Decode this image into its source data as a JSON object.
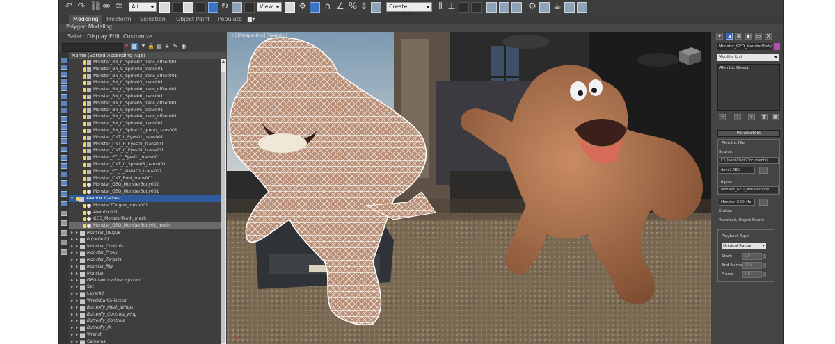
{
  "toolbar": {
    "selection_filter": "All",
    "ref_coord": "View",
    "named_selection": "Create Selection Se"
  },
  "ribbon": {
    "tabs": [
      "Modeling",
      "Freeform",
      "Selection",
      "Object Paint",
      "Populate"
    ],
    "active_tab": "Modeling",
    "sub_panel": "Polygon Modeling"
  },
  "scene_explorer": {
    "menu": [
      "Select",
      "Display",
      "Edit",
      "Customize"
    ],
    "column_header": "Name (Sorted Ascending Age)",
    "rows": [
      {
        "name": "Monster_BN_C_Spine02_trans_offset001",
        "kind": "node"
      },
      {
        "name": "Monster_BN_C_Spine02_trans001",
        "kind": "node"
      },
      {
        "name": "Monster_BN_C_Spine03_trans_offset001",
        "kind": "node"
      },
      {
        "name": "Monster_BN_C_Spine03_trans001",
        "kind": "node"
      },
      {
        "name": "Monster_BN_C_Spine06_trans_offset001",
        "kind": "node"
      },
      {
        "name": "Monster_BN_C_Spine06_trans001",
        "kind": "node"
      },
      {
        "name": "Monster_BN_C_Spine05_trans_offset001",
        "kind": "node"
      },
      {
        "name": "Monster_BN_C_Spine05_trans001",
        "kind": "node"
      },
      {
        "name": "Monster_BN_C_Spine04_trans_offset001",
        "kind": "node"
      },
      {
        "name": "Monster_BN_C_Spine04_trans001",
        "kind": "node"
      },
      {
        "name": "Monster_BN_C_Spine12_group_trans001",
        "kind": "node"
      },
      {
        "name": "Monster_CNT_L_Eyes01_trans001",
        "kind": "node"
      },
      {
        "name": "Monster_CNT_R_Eyes01_trans001",
        "kind": "node"
      },
      {
        "name": "Monster_CNT_C_Eyes01_trans001",
        "kind": "node"
      },
      {
        "name": "Monster_PT_C_Eyes01_trans001",
        "kind": "node"
      },
      {
        "name": "Monster_CNT_C_Spine06_trans001",
        "kind": "node"
      },
      {
        "name": "Monster_PT_C_Waist01_trans001",
        "kind": "node"
      },
      {
        "name": "Monster_CNT_Root_trans001",
        "kind": "node"
      },
      {
        "name": "Monster_GEO_MonsterBody002",
        "kind": "geo"
      },
      {
        "name": "Monster_GEO_MonsterBody001",
        "kind": "geo"
      },
      {
        "name": "Alembic Caches",
        "kind": "group"
      },
      {
        "name": "MonsterTOngue_mesh001",
        "kind": "child"
      },
      {
        "name": "Alembic001",
        "kind": "child"
      },
      {
        "name": "GEO_MonsterTeeth_mesh",
        "kind": "child"
      },
      {
        "name": "Monster_GEO_MonsterBody01_mesh",
        "kind": "childsel"
      },
      {
        "name": "Monster_tongue",
        "kind": "layer"
      },
      {
        "name": "0 (default)",
        "kind": "layer"
      },
      {
        "name": "Monster_Controls",
        "kind": "layer"
      },
      {
        "name": "Monster_Proxy",
        "kind": "layer"
      },
      {
        "name": "Monster_Targets",
        "kind": "layer"
      },
      {
        "name": "Monster_Rig",
        "kind": "layer"
      },
      {
        "name": "Monster",
        "kind": "layer"
      },
      {
        "name": "GEO textured background",
        "kind": "layer"
      },
      {
        "name": "Set",
        "kind": "layer"
      },
      {
        "name": "Layer02",
        "kind": "layer"
      },
      {
        "name": "WreckCarCollection",
        "kind": "layer"
      },
      {
        "name": "Butterfly_Mesh_Wings",
        "kind": "layer"
      },
      {
        "name": "Butterfly_Controls_wing",
        "kind": "layer"
      },
      {
        "name": "Butterfly_Controls",
        "kind": "layer"
      },
      {
        "name": "Butterfly_IK",
        "kind": "layer"
      },
      {
        "name": "Wrench",
        "kind": "layer"
      },
      {
        "name": "Cameras",
        "kind": "layer"
      }
    ]
  },
  "viewport": {
    "label": "[+] [Perspective] [Realistic]"
  },
  "command_panel": {
    "object_name": "Monster_GEO_MonsterBody0",
    "object_color": "#b04fb0",
    "modifier_list": "Modifier List",
    "stack_item": "Alembic Object",
    "parameters_title": "Parameters",
    "alembic_file_label": "Alembic File",
    "source_label": "Source:",
    "source_value": "C:\\Users\\Chris\\Documents\\",
    "file_value": "dave2.ABC",
    "object_label": "Object:",
    "object_value": "Monster_GEO_MonsterBody",
    "object_value2": "Monster_GEO_Mo",
    "status_label": "Status:",
    "status_value": "Resolved, Object Found",
    "playback_label": "Playback Type",
    "playback_value": "Original Range",
    "start_label": "Start:",
    "start_value": "1.0",
    "end_label": "End Frame:",
    "end_value": "40.0",
    "frame_label": "Frame:",
    "frame_value": "1.0",
    "browse": "..."
  },
  "colors": {
    "selection_blue": "#2f5b9c",
    "ui_gray": "#444444",
    "accent_blue": "#3b74c5"
  }
}
